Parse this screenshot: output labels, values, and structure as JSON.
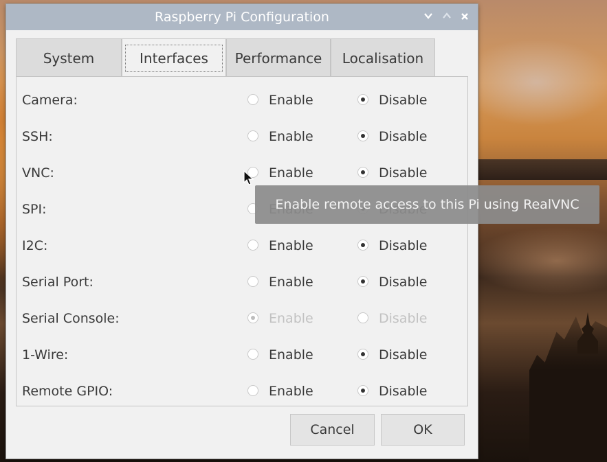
{
  "window": {
    "title": "Raspberry Pi Configuration",
    "controls": {
      "minimize": "⌄",
      "maximize": "^",
      "close": "×"
    }
  },
  "tabs": [
    {
      "label": "System",
      "active": false
    },
    {
      "label": "Interfaces",
      "active": true
    },
    {
      "label": "Performance",
      "active": false
    },
    {
      "label": "Localisation",
      "active": false
    }
  ],
  "interfaces": [
    {
      "label": "Camera:",
      "enable_label": "Enable",
      "disable_label": "Disable",
      "value": "Disable"
    },
    {
      "label": "SSH:",
      "enable_label": "Enable",
      "disable_label": "Disable",
      "value": "Disable"
    },
    {
      "label": "VNC:",
      "enable_label": "Enable",
      "disable_label": "Disable",
      "value": "Disable"
    },
    {
      "label": "SPI:",
      "enable_label": "Enable",
      "disable_label": "Disable",
      "value": "Disable"
    },
    {
      "label": "I2C:",
      "enable_label": "Enable",
      "disable_label": "Disable",
      "value": "Disable"
    },
    {
      "label": "Serial Port:",
      "enable_label": "Enable",
      "disable_label": "Disable",
      "value": "Disable"
    },
    {
      "label": "Serial Console:",
      "enable_label": "Enable",
      "disable_label": "Disable",
      "value": "Enable",
      "disabled": true
    },
    {
      "label": "1-Wire:",
      "enable_label": "Enable",
      "disable_label": "Disable",
      "value": "Disable"
    },
    {
      "label": "Remote GPIO:",
      "enable_label": "Enable",
      "disable_label": "Disable",
      "value": "Disable"
    }
  ],
  "buttons": {
    "cancel": "Cancel",
    "ok": "OK"
  },
  "tooltip": {
    "text": "Enable remote access to this Pi using RealVNC"
  },
  "colors": {
    "titlebar": "#aeb8c5",
    "window_bg": "#f1f1f1",
    "tooltip_bg": "#8c8c8c"
  }
}
